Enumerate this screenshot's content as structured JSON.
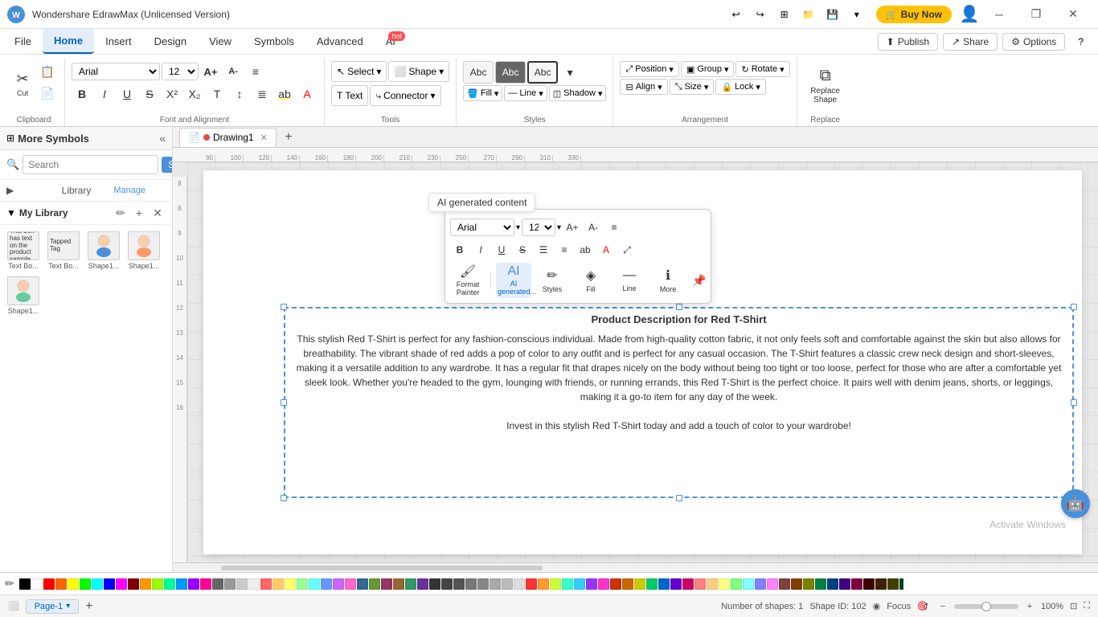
{
  "titlebar": {
    "title": "Wondershare EdrawMax (Unlicensed Version)",
    "buy_now": "Buy Now"
  },
  "menubar": {
    "items": [
      "File",
      "Home",
      "Insert",
      "Design",
      "View",
      "Symbols",
      "Advanced"
    ],
    "active": "Home",
    "ai_label": "AI",
    "right": {
      "publish": "Publish",
      "share": "Share",
      "options": "Options",
      "help": "?"
    }
  },
  "ribbon": {
    "groups": [
      {
        "name": "Clipboard",
        "label": "Clipboard",
        "buttons": [
          "✂",
          "✏",
          "📋",
          "📄"
        ]
      }
    ],
    "font_family": "Arial",
    "font_size": "12",
    "select_label": "Select",
    "shape_label": "Shape",
    "tools_label": "Tools",
    "connector_label": "Connector",
    "text_label": "Text",
    "styles_label": "Styles",
    "fill_label": "Fill",
    "line_label": "Line",
    "shadow_label": "Shadow",
    "position_label": "Position",
    "group_label": "Group",
    "rotate_label": "Rotate",
    "align_label": "Align",
    "size_label": "Size",
    "lock_label": "Lock",
    "replace_shape_label": "Replace Shape",
    "arrangement_label": "Arrangement",
    "replace_label": "Replace"
  },
  "sidebar": {
    "title": "More Symbols",
    "search_placeholder": "Search",
    "search_btn": "Search",
    "search_label": "Search",
    "library_label": "Library",
    "manage_label": "Manage",
    "my_library_label": "My Library",
    "shapes": [
      {
        "label": "Text Bo..."
      },
      {
        "label": "Text Bo..."
      },
      {
        "label": "Shape1..."
      },
      {
        "label": "Shape1..."
      },
      {
        "label": "Shape1..."
      }
    ]
  },
  "canvas": {
    "tab_name": "Drawing1",
    "ai_generated_label": "AI generated content",
    "textbox": {
      "title": "Product Description for Red T-Shirt",
      "body": "This stylish Red T-Shirt is perfect for any fashion-conscious individual. Made from high-quality cotton fabric, it not only feels soft and comfortable against the skin but also allows for breathability. The vibrant shade of red adds a pop of color to any outfit and is perfect for any casual occasion. The T-Shirt features a classic crew neck design and short-sleeves, making it a versatile addition to any wardrobe. It has a regular fit that drapes nicely on the body without being too tight or too loose, perfect for those who are after a comfortable yet sleek look. Whether you're headed to the gym, lounging with friends, or running errands, this Red T-Shirt is the perfect choice. It pairs well with denim jeans, shorts, or leggings, making it a go-to item for any day of the week.\n\nInvest in this stylish Red T-Shirt today and add a touch of color to your wardrobe!"
    }
  },
  "floating_toolbar": {
    "font": "Arial",
    "size": "12",
    "format_painter_label": "Format Painter",
    "ai_label": "AI generated...",
    "styles_label": "Styles",
    "fill_label": "Fill",
    "line_label": "Line",
    "more_label": "More"
  },
  "statusbar": {
    "page_label": "Page-1",
    "shapes_count": "Number of shapes: 1",
    "shape_id": "Shape ID: 102",
    "focus": "Focus",
    "zoom": "100%",
    "activate_windows": "Activate Windows"
  },
  "colors": [
    "#000000",
    "#ffffff",
    "#ff0000",
    "#ff6600",
    "#ffff00",
    "#00ff00",
    "#00ffff",
    "#0000ff",
    "#ff00ff",
    "#800000",
    "#ff9900",
    "#99ff00",
    "#00ff99",
    "#0099ff",
    "#9900ff",
    "#ff0099",
    "#666666",
    "#999999",
    "#cccccc",
    "#eeeeee",
    "#ff6666",
    "#ffcc66",
    "#ffff66",
    "#99ff99",
    "#66ffff",
    "#6699ff",
    "#cc66ff",
    "#ff66cc",
    "#336699",
    "#669933",
    "#993366",
    "#996633",
    "#339966",
    "#663399",
    "#333333",
    "#444444",
    "#555555",
    "#777777",
    "#888888",
    "#aaaaaa",
    "#bbbbbb",
    "#dddddd",
    "#ff3333",
    "#ff9933",
    "#ccff33",
    "#33ffcc",
    "#33ccff",
    "#9933ff",
    "#ff33cc",
    "#cc3300",
    "#cc6600",
    "#cccc00",
    "#00cc66",
    "#0066cc",
    "#6600cc",
    "#cc0066",
    "#ff8080",
    "#ffcc80",
    "#ffff80",
    "#80ff80",
    "#80ffff",
    "#8080ff",
    "#ff80ff",
    "#804040",
    "#804000",
    "#808000",
    "#008040",
    "#004080",
    "#400080",
    "#800040",
    "#400000",
    "#402000",
    "#404000",
    "#004020",
    "#002040",
    "#200040",
    "#400020",
    "#c0c0c0",
    "#a0a0a0",
    "#808080",
    "#600000",
    "#603000",
    "#606000",
    "#006030",
    "#003060",
    "#300060",
    "#600030",
    "#200020",
    "#ff4444",
    "#ff8844"
  ]
}
